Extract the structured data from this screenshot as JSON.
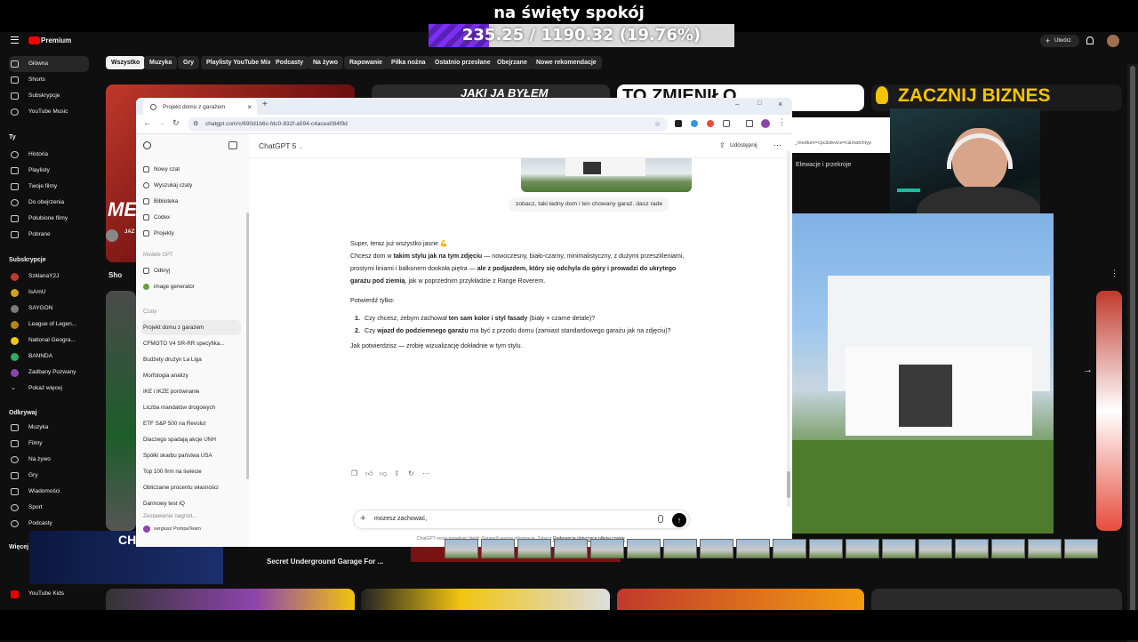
{
  "stream": {
    "title": "na święty spokój",
    "goal_text": "235.25 / 1190.32 (19.76%)",
    "goal_fraction": 0.1976
  },
  "youtube": {
    "logo": "Premium",
    "create_label": "Utwórz",
    "chips": [
      "Wszystko",
      "Muzyka",
      "Gry",
      "Playlisty YouTube Mix",
      "Podcasty",
      "Na żywo",
      "Rapowanie",
      "Piłka nożna",
      "Ostatnio przesłane",
      "Obejrzane",
      "Nowe rekomendacje"
    ],
    "sidebar_main": [
      "Główna",
      "Shorts",
      "Subskrypcje",
      "YouTube Music"
    ],
    "you_head": "Ty",
    "sidebar_you": [
      "Historia",
      "Playlisty",
      "Twoje filmy",
      "Do obejrzenia",
      "Polubione filmy",
      "Pobrane"
    ],
    "subs_head": "Subskrypcje",
    "subscriptions": [
      "SzklanaY2J",
      "IsAmU",
      "SAYGON",
      "League of Legen...",
      "National Geogra...",
      "BANNDA",
      "Zadbany Pozwany"
    ],
    "show_more": "Pokaż więcej",
    "explore_head": "Odkrywaj",
    "explore": [
      "Muzyka",
      "Filmy",
      "Na żywo",
      "Gry",
      "Wiadomości",
      "Sport",
      "Podcasty"
    ],
    "more_head": "Więcej z",
    "kids": "YouTube Kids",
    "shorts_label": "Sho",
    "video_title_bottom": "Secret Underground Garage For ...",
    "banner_jaki": "JAKI JA BYŁEM",
    "banner_zmienil": "TO ZMIENIŁO",
    "banner_biznes": "ZACZNIJ BIZNES",
    "check_out": "CHECK OUT",
    "me_text": "ME",
    "channel_short": "JAZ",
    "elevations": "Elewacje i przekroje",
    "url_fragment": "_medium=cpc&device=c&matchtyp"
  },
  "browser": {
    "tab_title": "Projekt domu z garażem",
    "url": "chatgpt.com/c/690d1b6c-fdc0-832f-a594-c4acea084f9d"
  },
  "chatgpt": {
    "model": "ChatGPT 5",
    "share": "Udostępnij",
    "nav": [
      "Nowy czat",
      "Wyszukaj czaty",
      "Biblioteka",
      "Codex",
      "Projekty"
    ],
    "models_head": "Modele GPT",
    "gpts": [
      "Odkryj",
      "image generator"
    ],
    "chats_head": "Czaty",
    "chats": [
      "Projekt domu z garażem",
      "CFMOTO V4 SR-RR specyfika...",
      "Budżety drużyn La Liga",
      "Morfologia analizy",
      "IKE i IKZE porównanie",
      "Liczba mandatów drogowych",
      "ETF S&P 500 na Revolut",
      "Dlaczego spadają akcje UNH",
      "Spółki skarbu państwa USA",
      "Top 100 firm na świecie",
      "Obliczanie procentu własności",
      "Darmowy test IQ",
      "Zestawienie nagród..."
    ],
    "user_name": "sergiusz PompaTeam",
    "user_msg": "zobacz, taki ładny dom i ten chowany garaż. dasz rade",
    "reply": {
      "line1": "Super, teraz już wszystko jasne 💪",
      "p1_a": "Chcesz dom w ",
      "p1_b": "takim stylu jak na tym zdjęciu",
      "p1_c": " — nowoczesny, biało-czarny, minimalistyczny, z dużymi przeszkleniami, prostymi liniami i balkonem dookoła piętra — ",
      "p1_d": "ale z podjazdem, który się odchyla do góry i prowadzi do ukrytego garażu pod ziemią",
      "p1_e": ", jak w poprzednim przykładzie z Range Roverem.",
      "confirm": "Potwierdź tylko:",
      "q1_a": "Czy chcesz, żebym zachował ",
      "q1_b": "ten sam kolor i styl fasady",
      "q1_c": " (biały + czarne detale)?",
      "q2_a": "Czy ",
      "q2_b": "wjazd do podziemnego garażu",
      "q2_c": " ma być z przodu domu (zamiast standardowego garażu jak na zdjęciu)?",
      "outro": "Jak potwierdzisz — zrobię wizualizację dokładnie w tym stylu."
    },
    "input_value": "mozesz zachować,",
    "disclaimer_a": "ChatGPT może popełniać błędy. Sprawdź ważne informacje. Zobacz ",
    "disclaimer_b": "Preferencje dotyczące plików cookie",
    "disclaimer_c": "."
  }
}
